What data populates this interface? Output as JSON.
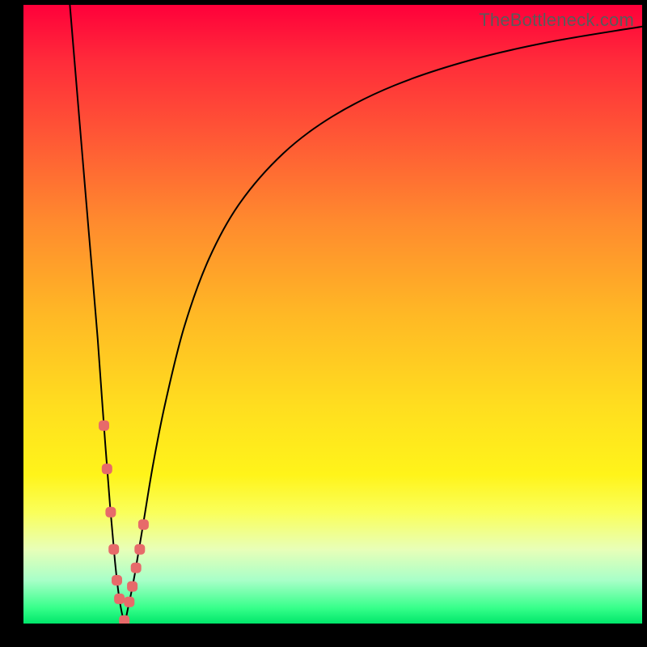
{
  "watermark": "TheBottleneck.com",
  "colors": {
    "frame": "#000000",
    "curve": "#000000",
    "marker": "#e76a6a"
  },
  "chart_data": {
    "type": "line",
    "title": "",
    "xlabel": "",
    "ylabel": "",
    "xlim": [
      0,
      100
    ],
    "ylim": [
      0,
      100
    ],
    "grid": false,
    "legend": false,
    "series": [
      {
        "name": "bottleneck-curve",
        "x": [
          7.5,
          9,
          10.5,
          12,
          13,
          14,
          14.8,
          15.5,
          16.3,
          17,
          18,
          19.5,
          21,
          23,
          26,
          30,
          35,
          42,
          50,
          60,
          72,
          85,
          100
        ],
        "y": [
          100,
          82,
          64,
          46,
          32,
          19,
          10,
          4,
          0.5,
          3,
          8,
          17,
          26,
          36,
          48,
          59,
          68,
          76,
          82,
          87,
          91,
          94,
          96.5
        ]
      }
    ],
    "markers": {
      "name": "highlighted-points",
      "x": [
        13.0,
        13.5,
        14.1,
        14.6,
        15.1,
        15.5,
        16.3,
        17.1,
        17.6,
        18.2,
        18.8,
        19.4
      ],
      "y": [
        32,
        25,
        18,
        12,
        7,
        4,
        0.5,
        3.5,
        6,
        9,
        12,
        16
      ]
    }
  }
}
